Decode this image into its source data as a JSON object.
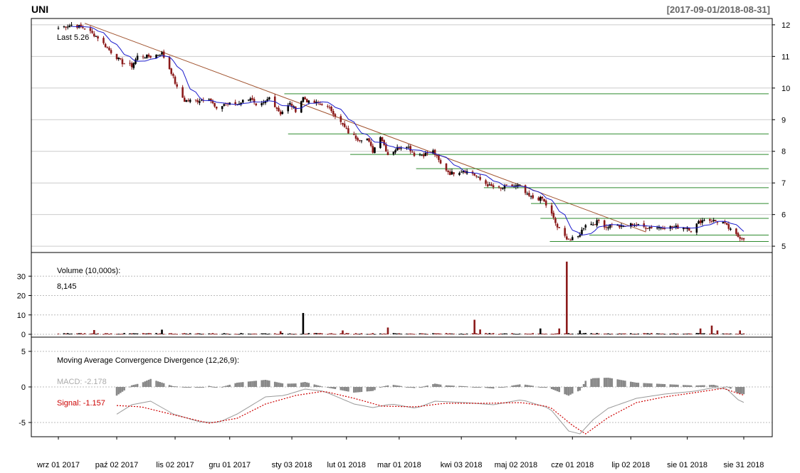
{
  "chart_data": [
    {
      "type": "candlestick",
      "title": "UNI",
      "date_range": "[2017-09-01/2018-08-31]",
      "last_label": "Last 5.26",
      "ylim": [
        5,
        12
      ],
      "yticks": [
        5,
        6,
        7,
        8,
        9,
        10,
        11,
        12
      ],
      "grid": true,
      "up_color": "#000000",
      "down_color": "#8B1A1A",
      "ma_color": "#1a1acc",
      "trendline_color": "#a0522d",
      "level_color": "#2e8b2e",
      "trendline": [
        {
          "date": "2017-09-15",
          "price": 12.05
        },
        {
          "date": "2018-07-10",
          "price": 5.45
        }
      ],
      "levels": [
        {
          "price": 9.82,
          "from": "2017-12-30"
        },
        {
          "price": 8.55,
          "from": "2018-01-01"
        },
        {
          "price": 7.9,
          "from": "2018-02-03"
        },
        {
          "price": 7.45,
          "from": "2018-03-10"
        },
        {
          "price": 6.85,
          "from": "2018-04-15"
        },
        {
          "price": 6.35,
          "from": "2018-05-10"
        },
        {
          "price": 5.88,
          "from": "2018-05-15"
        },
        {
          "price": 5.35,
          "from": "2018-06-10"
        },
        {
          "price": 5.15,
          "from": "2018-05-20"
        }
      ],
      "close_keypoints": [
        [
          "2017-09-01",
          11.9
        ],
        [
          "2017-09-08",
          12.0
        ],
        [
          "2017-09-15",
          11.9
        ],
        [
          "2017-09-22",
          11.6
        ],
        [
          "2017-09-28",
          11.2
        ],
        [
          "2017-10-05",
          10.8
        ],
        [
          "2017-10-10",
          10.7
        ],
        [
          "2017-10-13",
          11.0
        ],
        [
          "2017-10-20",
          11.0
        ],
        [
          "2017-10-26",
          11.1
        ],
        [
          "2017-10-31",
          10.5
        ],
        [
          "2017-11-03",
          10.0
        ],
        [
          "2017-11-07",
          9.6
        ],
        [
          "2017-11-14",
          9.6
        ],
        [
          "2017-11-20",
          9.7
        ],
        [
          "2017-11-24",
          9.3
        ],
        [
          "2017-11-28",
          9.5
        ],
        [
          "2017-12-05",
          9.5
        ],
        [
          "2017-12-08",
          9.6
        ],
        [
          "2017-12-12",
          9.7
        ],
        [
          "2017-12-15",
          9.4
        ],
        [
          "2017-12-19",
          9.5
        ],
        [
          "2017-12-22",
          9.7
        ],
        [
          "2017-12-28",
          9.2
        ],
        [
          "2018-01-02",
          9.5
        ],
        [
          "2018-01-05",
          9.3
        ],
        [
          "2018-01-09",
          9.7
        ],
        [
          "2018-01-12",
          9.55
        ],
        [
          "2018-01-19",
          9.5
        ],
        [
          "2018-01-24",
          9.3
        ],
        [
          "2018-01-29",
          8.9
        ],
        [
          "2018-02-02",
          8.6
        ],
        [
          "2018-02-07",
          8.4
        ],
        [
          "2018-02-12",
          8.4
        ],
        [
          "2018-02-15",
          8.0
        ],
        [
          "2018-02-19",
          8.5
        ],
        [
          "2018-02-23",
          7.9
        ],
        [
          "2018-02-28",
          8.1
        ],
        [
          "2018-03-05",
          8.2
        ],
        [
          "2018-03-09",
          7.9
        ],
        [
          "2018-03-14",
          7.9
        ],
        [
          "2018-03-19",
          8.0
        ],
        [
          "2018-03-23",
          7.6
        ],
        [
          "2018-03-28",
          7.3
        ],
        [
          "2018-04-04",
          7.4
        ],
        [
          "2018-04-09",
          7.3
        ],
        [
          "2018-04-13",
          7.1
        ],
        [
          "2018-04-18",
          6.9
        ],
        [
          "2018-04-24",
          6.8
        ],
        [
          "2018-04-27",
          6.9
        ],
        [
          "2018-05-04",
          6.9
        ],
        [
          "2018-05-08",
          6.6
        ],
        [
          "2018-05-12",
          6.5
        ],
        [
          "2018-05-16",
          6.5
        ],
        [
          "2018-05-21",
          6.0
        ],
        [
          "2018-05-24",
          5.6
        ],
        [
          "2018-05-28",
          5.3
        ],
        [
          "2018-05-31",
          5.2
        ],
        [
          "2018-06-04",
          5.3
        ],
        [
          "2018-06-08",
          5.7
        ],
        [
          "2018-06-12",
          5.7
        ],
        [
          "2018-06-15",
          5.8
        ],
        [
          "2018-06-19",
          5.6
        ],
        [
          "2018-06-22",
          5.7
        ],
        [
          "2018-06-27",
          5.6
        ],
        [
          "2018-07-03",
          5.7
        ],
        [
          "2018-07-09",
          5.6
        ],
        [
          "2018-07-16",
          5.6
        ],
        [
          "2018-07-20",
          5.6
        ],
        [
          "2018-07-26",
          5.6
        ],
        [
          "2018-08-01",
          5.6
        ],
        [
          "2018-08-03",
          5.5
        ],
        [
          "2018-08-07",
          5.75
        ],
        [
          "2018-08-10",
          5.85
        ],
        [
          "2018-08-15",
          5.8
        ],
        [
          "2018-08-20",
          5.75
        ],
        [
          "2018-08-24",
          5.5
        ],
        [
          "2018-08-28",
          5.3
        ],
        [
          "2018-08-31",
          5.26
        ]
      ]
    },
    {
      "type": "bar",
      "title": "Volume (10,000s):",
      "last_value": "8,145",
      "ylim": [
        0,
        38
      ],
      "yticks": [
        0,
        10,
        20,
        30
      ],
      "spikes": [
        {
          "date": "2017-09-20",
          "value": 2.2
        },
        {
          "date": "2017-10-26",
          "value": 2.4
        },
        {
          "date": "2017-12-10",
          "value": 1.5
        },
        {
          "date": "2017-12-28",
          "value": 1.6
        },
        {
          "date": "2018-01-06",
          "value": 10.8
        },
        {
          "date": "2018-01-09",
          "value": 11.0
        },
        {
          "date": "2018-01-30",
          "value": 2.0
        },
        {
          "date": "2018-02-23",
          "value": 3.5
        },
        {
          "date": "2018-04-10",
          "value": 7.5
        },
        {
          "date": "2018-04-13",
          "value": 2.5
        },
        {
          "date": "2018-05-15",
          "value": 3.0
        },
        {
          "date": "2018-05-25",
          "value": 3.0
        },
        {
          "date": "2018-05-29",
          "value": 37.5
        },
        {
          "date": "2018-06-05",
          "value": 2.0
        },
        {
          "date": "2018-08-08",
          "value": 3.0
        },
        {
          "date": "2018-08-14",
          "value": 4.5
        },
        {
          "date": "2018-08-17",
          "value": 2.0
        },
        {
          "date": "2018-08-25",
          "value": 5.5
        },
        {
          "date": "2018-08-29",
          "value": 2.0
        }
      ]
    },
    {
      "type": "line",
      "title": "Moving Average Convergence Divergence (12,26,9):",
      "ylim": [
        -7,
        7
      ],
      "yticks": [
        -5,
        0,
        5
      ],
      "macd_label": "MACD: -2.178",
      "signal_label": "Signal: -1.157",
      "macd_color": "#999999",
      "signal_color": "#cc0000",
      "macd_keypoints": [
        [
          "2017-10-01",
          -4.0
        ],
        [
          "2017-10-10",
          -2.5
        ],
        [
          "2017-10-20",
          -2.0
        ],
        [
          "2017-11-01",
          -3.8
        ],
        [
          "2017-11-15",
          -4.9
        ],
        [
          "2017-11-25",
          -5.0
        ],
        [
          "2017-12-05",
          -3.8
        ],
        [
          "2017-12-20",
          -1.4
        ],
        [
          "2017-12-30",
          -1.2
        ],
        [
          "2018-01-10",
          -0.3
        ],
        [
          "2018-01-20",
          -0.6
        ],
        [
          "2018-02-05",
          -2.4
        ],
        [
          "2018-02-15",
          -2.9
        ],
        [
          "2018-02-25",
          -2.4
        ],
        [
          "2018-03-10",
          -3.0
        ],
        [
          "2018-03-20",
          -2.0
        ],
        [
          "2018-04-05",
          -2.2
        ],
        [
          "2018-04-20",
          -2.5
        ],
        [
          "2018-05-05",
          -1.8
        ],
        [
          "2018-05-20",
          -3.0
        ],
        [
          "2018-05-30",
          -6.2
        ],
        [
          "2018-06-05",
          -6.6
        ],
        [
          "2018-06-12",
          -4.6
        ],
        [
          "2018-06-20",
          -3.0
        ],
        [
          "2018-07-05",
          -1.6
        ],
        [
          "2018-07-20",
          -1.0
        ],
        [
          "2018-08-05",
          -0.6
        ],
        [
          "2018-08-15",
          -0.1
        ],
        [
          "2018-08-22",
          -0.3
        ],
        [
          "2018-08-28",
          -1.8
        ],
        [
          "2018-08-31",
          -2.178
        ]
      ],
      "signal_keypoints": [
        [
          "2017-10-01",
          -2.6
        ],
        [
          "2017-10-15",
          -2.8
        ],
        [
          "2017-11-01",
          -3.9
        ],
        [
          "2017-11-20",
          -5.1
        ],
        [
          "2017-12-05",
          -4.4
        ],
        [
          "2017-12-20",
          -2.4
        ],
        [
          "2018-01-05",
          -1.2
        ],
        [
          "2018-01-20",
          -0.6
        ],
        [
          "2018-02-05",
          -1.6
        ],
        [
          "2018-02-20",
          -2.7
        ],
        [
          "2018-03-10",
          -2.8
        ],
        [
          "2018-03-25",
          -2.3
        ],
        [
          "2018-04-15",
          -2.3
        ],
        [
          "2018-05-05",
          -2.2
        ],
        [
          "2018-05-20",
          -2.8
        ],
        [
          "2018-06-01",
          -5.4
        ],
        [
          "2018-06-08",
          -6.6
        ],
        [
          "2018-06-20",
          -4.3
        ],
        [
          "2018-07-05",
          -2.2
        ],
        [
          "2018-07-20",
          -1.4
        ],
        [
          "2018-08-05",
          -0.8
        ],
        [
          "2018-08-20",
          -0.2
        ],
        [
          "2018-08-31",
          -1.157
        ]
      ]
    }
  ],
  "x_axis": {
    "start": "2017-09-01",
    "end": "2018-08-31",
    "ticks": [
      {
        "date": "2017-09-01",
        "label": "wrz 01 2017"
      },
      {
        "date": "2017-10-02",
        "label": "paź 02 2017"
      },
      {
        "date": "2017-11-02",
        "label": "lis 02 2017"
      },
      {
        "date": "2017-12-01",
        "label": "gru 01 2017"
      },
      {
        "date": "2018-01-03",
        "label": "sty 03 2018"
      },
      {
        "date": "2018-02-01",
        "label": "lut 01 2018"
      },
      {
        "date": "2018-03-01",
        "label": "mar 01 2018"
      },
      {
        "date": "2018-04-03",
        "label": "kwi 03 2018"
      },
      {
        "date": "2018-05-02",
        "label": "maj 02 2018"
      },
      {
        "date": "2018-06-01",
        "label": "cze 01 2018"
      },
      {
        "date": "2018-07-02",
        "label": "lip 02 2018"
      },
      {
        "date": "2018-08-01",
        "label": "sie 01 2018"
      },
      {
        "date": "2018-08-31",
        "label": "sie 31 2018"
      }
    ]
  }
}
